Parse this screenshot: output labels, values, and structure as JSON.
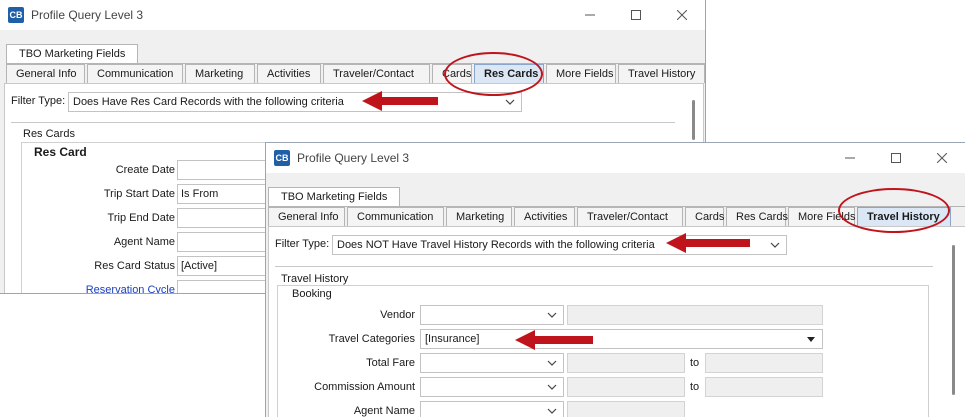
{
  "windows": {
    "back": {
      "title": "Profile Query Level 3",
      "top_tab": "TBO Marketing Fields",
      "tabs": [
        "General Info",
        "Communication",
        "Marketing",
        "Activities",
        "Traveler/Contact",
        "Cards",
        "Res Cards",
        "More Fields",
        "Travel History"
      ],
      "active_tab": "Res Cards",
      "filter_label": "Filter Type:",
      "filter_value": "Does Have Res Card Records with the following criteria",
      "section_label": "Res Cards",
      "group_title": "Res Card",
      "fields": [
        {
          "label": "Create Date",
          "value": ""
        },
        {
          "label": "Trip Start Date",
          "value": "Is From"
        },
        {
          "label": "Trip End Date",
          "value": ""
        },
        {
          "label": "Agent Name",
          "value": ""
        },
        {
          "label": "Res Card Status",
          "value": "[Active]"
        },
        {
          "label": "Reservation Cycle",
          "value": ""
        }
      ]
    },
    "front": {
      "title": "Profile Query Level 3",
      "top_tab": "TBO Marketing Fields",
      "tabs": [
        "General Info",
        "Communication",
        "Marketing",
        "Activities",
        "Traveler/Contact",
        "Cards",
        "Res Cards",
        "More Fields",
        "Travel History"
      ],
      "active_tab": "Travel History",
      "filter_label": "Filter Type:",
      "filter_value": "Does NOT Have Travel History Records with the following criteria",
      "section_label": "Travel History",
      "group_title": "Booking",
      "fields": [
        {
          "label": "Vendor",
          "value": ""
        },
        {
          "label": "Travel Categories",
          "value": "[Insurance]"
        },
        {
          "label": "Total Fare",
          "value": "",
          "to_label": "to"
        },
        {
          "label": "Commission Amount",
          "value": "",
          "to_label": "to"
        },
        {
          "label": "Agent Name",
          "value": ""
        }
      ]
    }
  },
  "icons": {
    "app": "CB",
    "minimize": "minimize-icon",
    "maximize": "maximize-icon",
    "close": "close-icon",
    "dropdown": "chevron-down-icon"
  },
  "colors": {
    "annotation_red": "#c0141c",
    "link_blue": "#1a3fbf",
    "active_tab_bg": "#dce7f5"
  }
}
